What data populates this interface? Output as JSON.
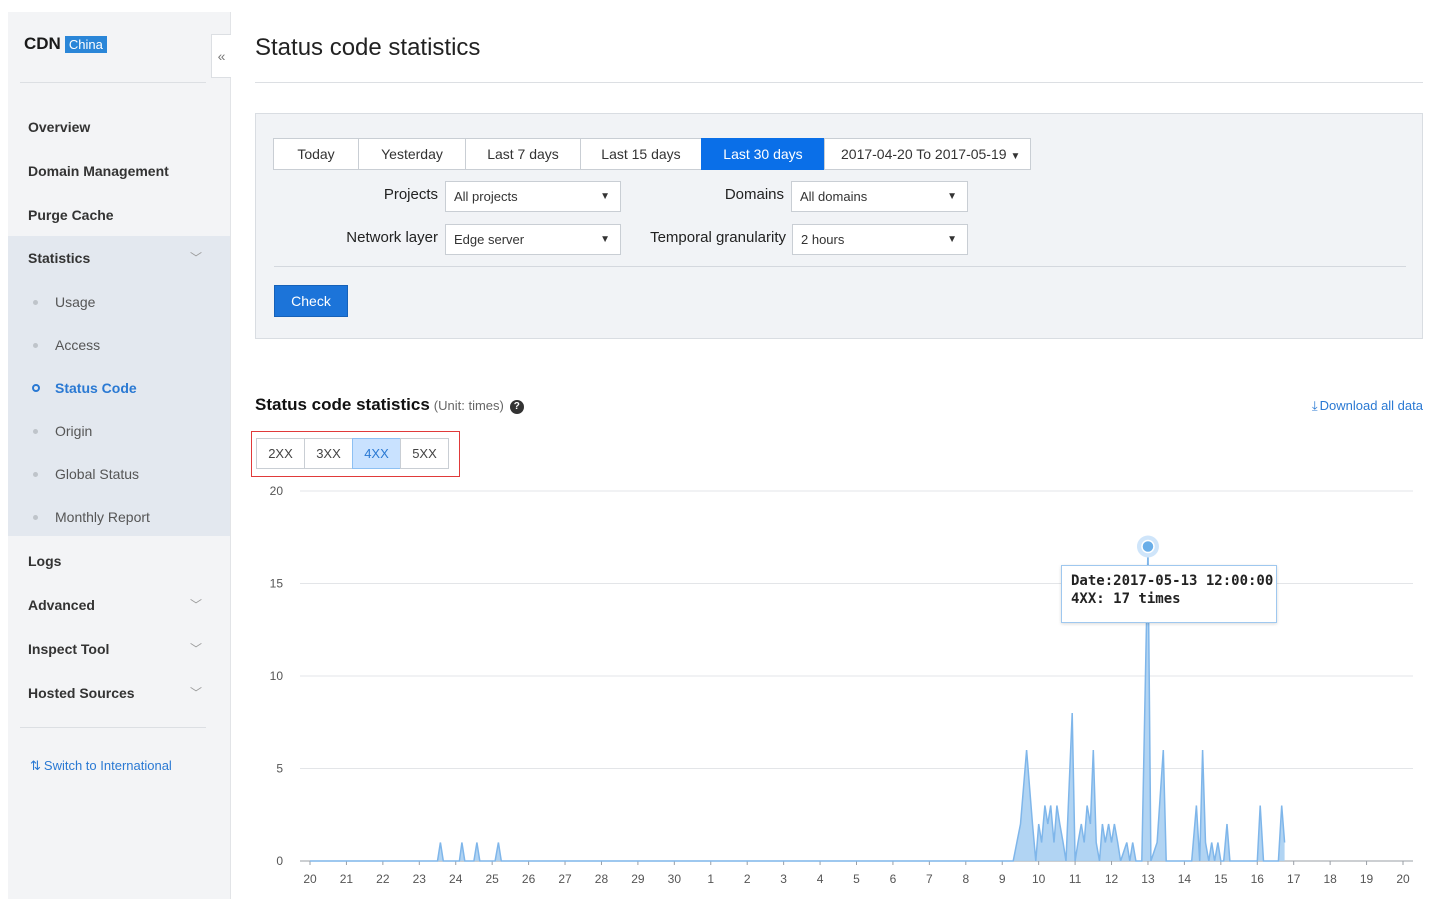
{
  "brand": {
    "name": "CDN",
    "badge": "China"
  },
  "sidebar": {
    "collapse_glyph": "«",
    "items": [
      {
        "label": "Overview"
      },
      {
        "label": "Domain Management"
      },
      {
        "label": "Purge Cache"
      },
      {
        "label": "Statistics",
        "expanded": true
      }
    ],
    "statistics_sub": [
      {
        "label": "Usage"
      },
      {
        "label": "Access"
      },
      {
        "label": "Status Code",
        "active": true
      },
      {
        "label": "Origin"
      },
      {
        "label": "Global Status"
      },
      {
        "label": "Monthly Report"
      }
    ],
    "items_after": [
      {
        "label": "Logs"
      },
      {
        "label": "Advanced",
        "has_chevron": true
      },
      {
        "label": "Inspect Tool",
        "has_chevron": true
      },
      {
        "label": "Hosted Sources",
        "has_chevron": true
      }
    ],
    "switch_link": "Switch to International"
  },
  "page": {
    "title": "Status code statistics"
  },
  "filters": {
    "range_tabs": [
      "Today",
      "Yesterday",
      "Last 7 days",
      "Last 15 days",
      "Last 30 days"
    ],
    "active_range": "Last 30 days",
    "date_range": "2017-04-20 To 2017-05-19",
    "projects_label": "Projects",
    "projects_value": "All projects",
    "domains_label": "Domains",
    "domains_value": "All domains",
    "network_label": "Network layer",
    "network_value": "Edge server",
    "granularity_label": "Temporal granularity",
    "granularity_value": "2 hours",
    "check_label": "Check"
  },
  "section": {
    "title": "Status code statistics",
    "unit": "(Unit: times)",
    "help": "?",
    "download": "Download all data"
  },
  "code_tabs": [
    "2XX",
    "3XX",
    "4XX",
    "5XX"
  ],
  "active_code": "4XX",
  "colors": {
    "accent": "#1c74d9",
    "series_fill": "#a9cff2",
    "series_line": "#7fb6ea"
  },
  "chart_data": {
    "type": "area",
    "ylim": [
      0,
      20
    ],
    "yticks": [
      0,
      5,
      10,
      15,
      20
    ],
    "x_tick_labels": [
      "20",
      "21",
      "22",
      "23",
      "24",
      "25",
      "26",
      "27",
      "28",
      "29",
      "30",
      "1",
      "2",
      "3",
      "4",
      "5",
      "6",
      "7",
      "8",
      "9",
      "10",
      "11",
      "12",
      "13",
      "14",
      "15",
      "16",
      "17",
      "18",
      "19",
      "20"
    ],
    "x_range_days": [
      0,
      30
    ],
    "grid": true,
    "series": [
      {
        "name": "4XX",
        "points": [
          [
            0,
            0
          ],
          [
            3.5,
            0
          ],
          [
            3.58,
            1
          ],
          [
            3.66,
            0
          ],
          [
            4.1,
            0
          ],
          [
            4.17,
            1
          ],
          [
            4.25,
            0
          ],
          [
            4.5,
            0
          ],
          [
            4.58,
            1
          ],
          [
            4.66,
            0
          ],
          [
            5.08,
            0
          ],
          [
            5.17,
            1
          ],
          [
            5.25,
            0
          ],
          [
            19.3,
            0
          ],
          [
            19.5,
            2
          ],
          [
            19.67,
            6
          ],
          [
            19.83,
            2
          ],
          [
            19.92,
            0
          ],
          [
            20.0,
            2
          ],
          [
            20.08,
            1
          ],
          [
            20.17,
            3
          ],
          [
            20.25,
            2
          ],
          [
            20.33,
            3
          ],
          [
            20.42,
            1
          ],
          [
            20.5,
            3
          ],
          [
            20.58,
            2
          ],
          [
            20.67,
            1
          ],
          [
            20.75,
            0
          ],
          [
            20.92,
            8
          ],
          [
            21.0,
            0
          ],
          [
            21.08,
            1
          ],
          [
            21.17,
            2
          ],
          [
            21.25,
            1
          ],
          [
            21.33,
            3
          ],
          [
            21.42,
            2
          ],
          [
            21.5,
            6
          ],
          [
            21.58,
            1
          ],
          [
            21.67,
            0
          ],
          [
            21.75,
            2
          ],
          [
            21.83,
            1
          ],
          [
            21.92,
            2
          ],
          [
            22.0,
            1
          ],
          [
            22.08,
            2
          ],
          [
            22.17,
            1
          ],
          [
            22.25,
            0
          ],
          [
            22.42,
            1
          ],
          [
            22.5,
            0
          ],
          [
            22.58,
            1
          ],
          [
            22.67,
            0
          ],
          [
            22.75,
            0
          ],
          [
            22.83,
            0
          ],
          [
            23.0,
            17
          ],
          [
            23.08,
            0
          ],
          [
            23.25,
            1
          ],
          [
            23.42,
            6
          ],
          [
            23.5,
            0
          ],
          [
            24.2,
            0
          ],
          [
            24.33,
            3
          ],
          [
            24.42,
            0
          ],
          [
            24.5,
            6
          ],
          [
            24.58,
            1
          ],
          [
            24.67,
            0
          ],
          [
            24.75,
            1
          ],
          [
            24.83,
            0
          ],
          [
            24.92,
            1
          ],
          [
            25.0,
            0
          ],
          [
            25.08,
            0
          ],
          [
            25.17,
            2
          ],
          [
            25.25,
            0
          ],
          [
            26.0,
            0
          ],
          [
            26.08,
            3
          ],
          [
            26.17,
            0
          ],
          [
            26.58,
            0
          ],
          [
            26.67,
            3
          ],
          [
            26.75,
            1
          ]
        ]
      }
    ],
    "tooltip": {
      "date": "Date:2017-05-13 12:00:00",
      "value_line": "4XX: 17 times"
    }
  }
}
